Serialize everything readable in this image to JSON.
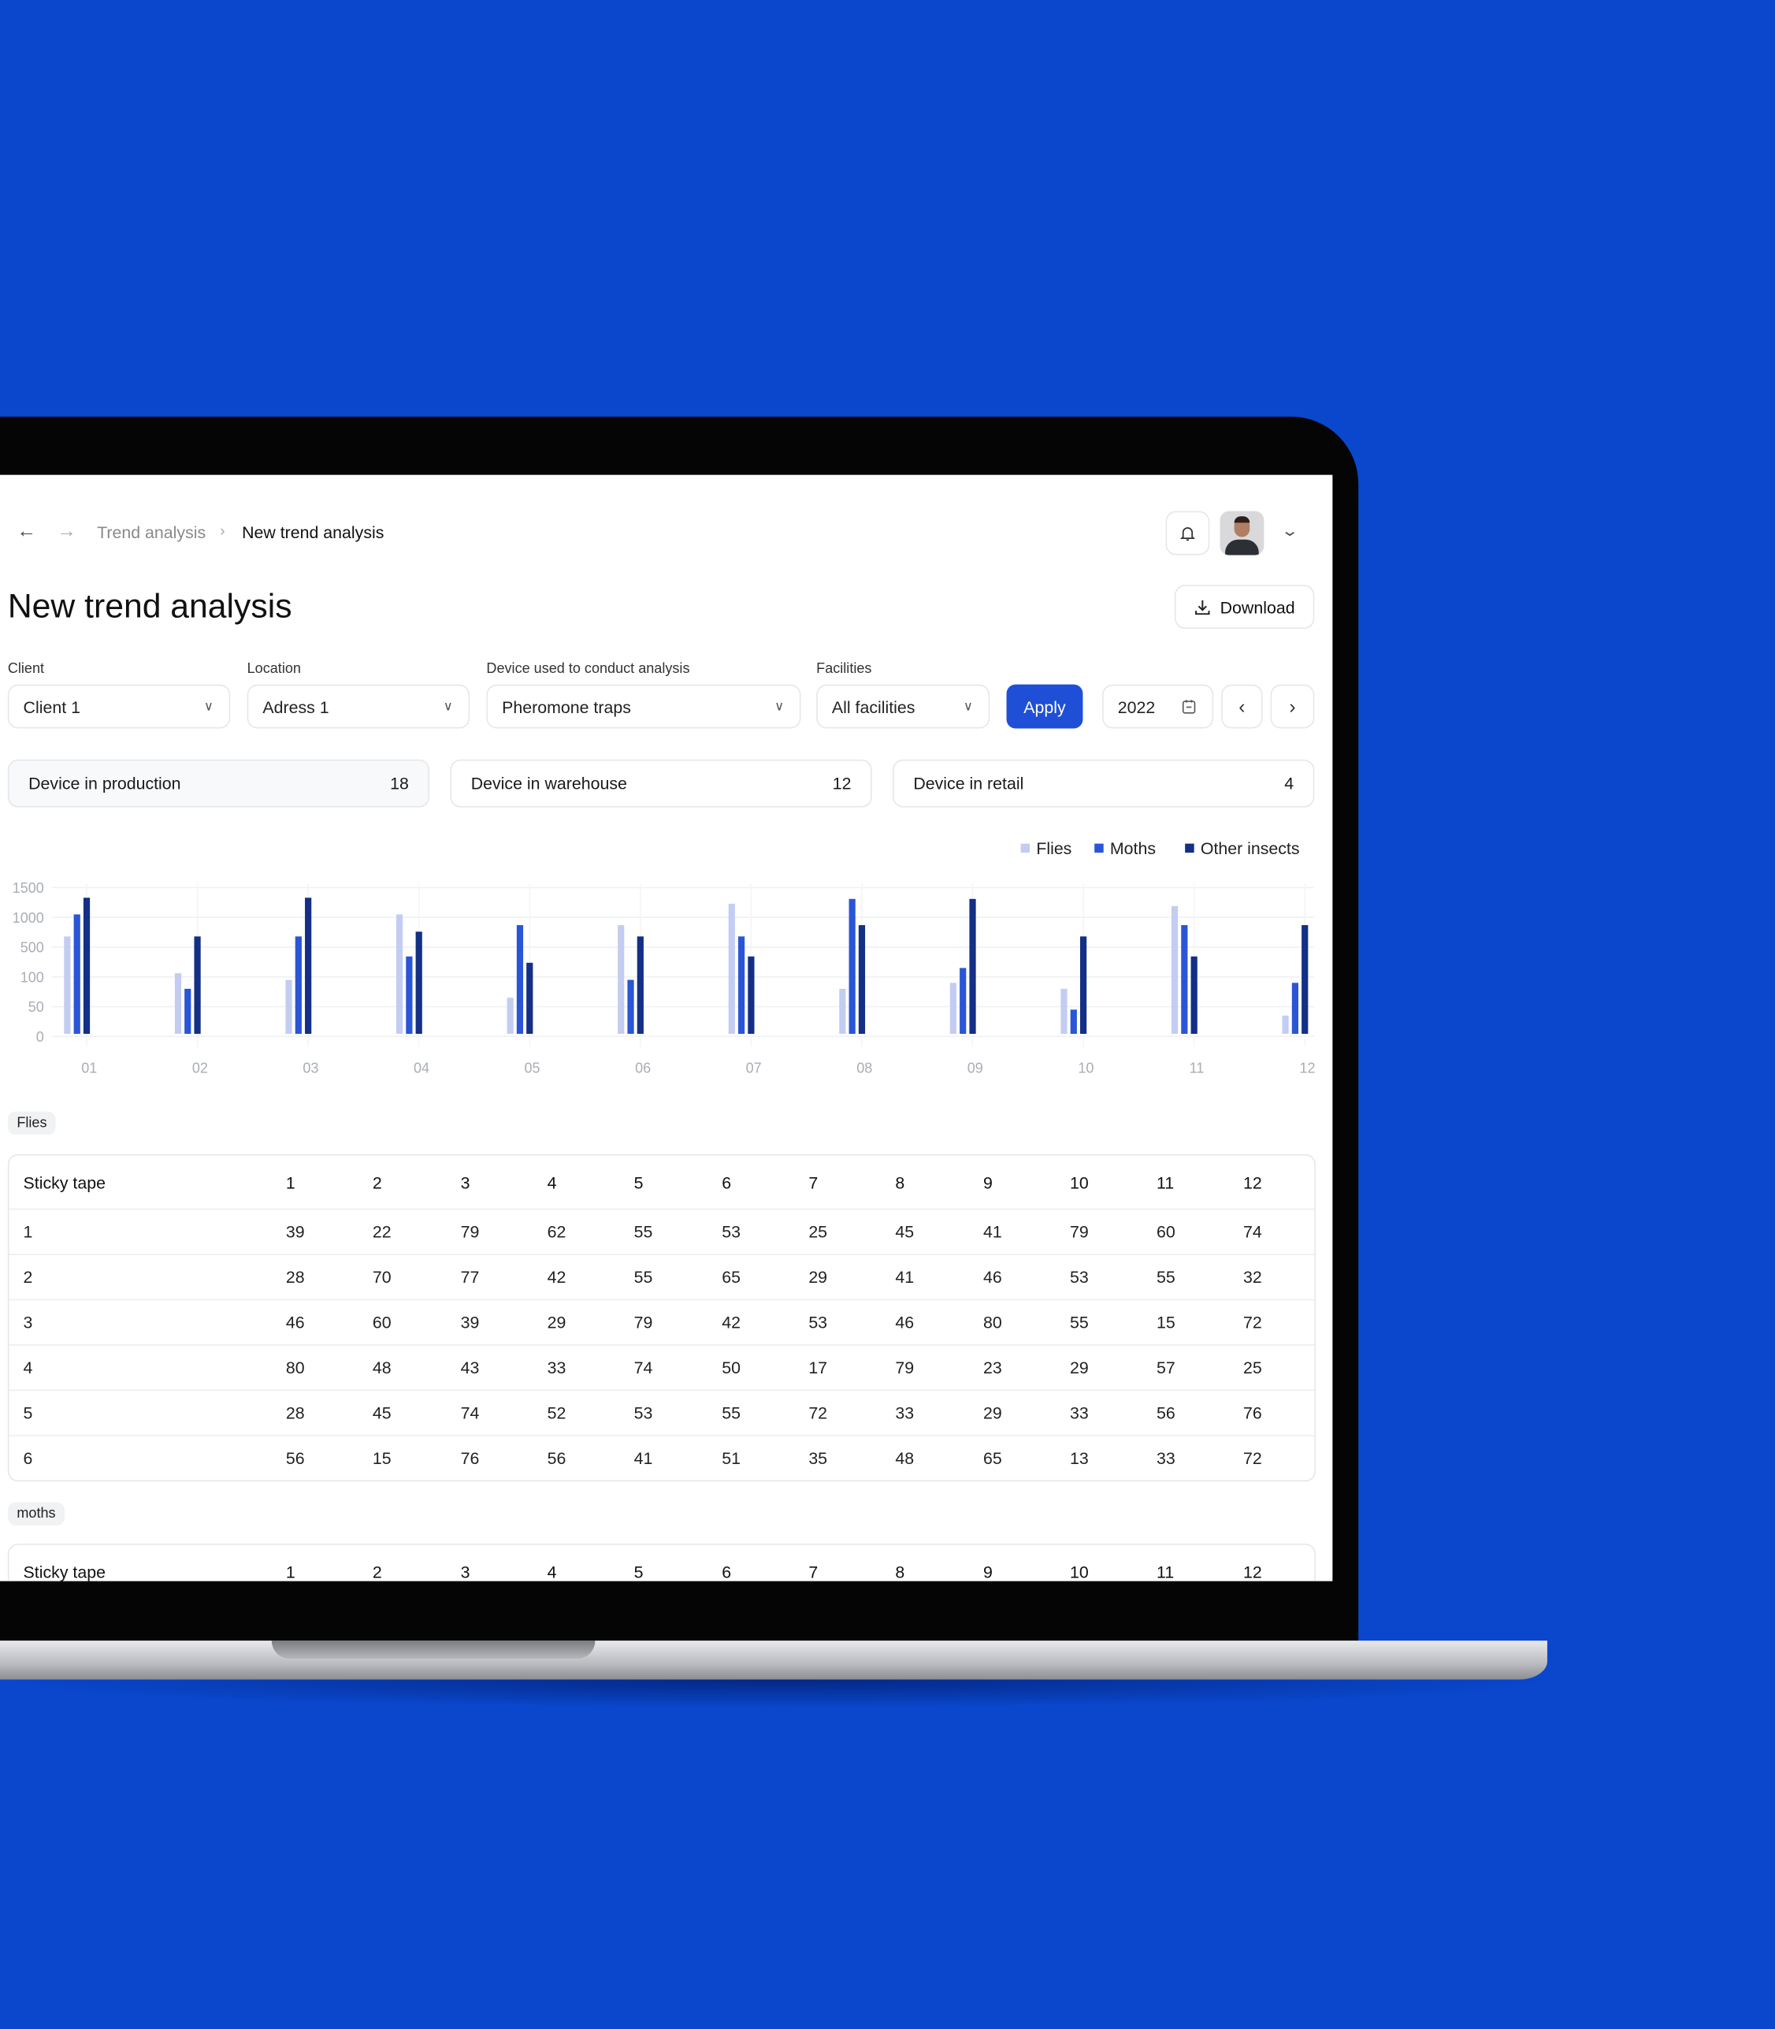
{
  "nav": {
    "back_icon": "arrow-left-icon",
    "forward_icon": "arrow-right-icon",
    "breadcrumb": [
      "Trend analysis",
      "New trend analysis"
    ],
    "avatar_alt": "user avatar"
  },
  "header": {
    "title": "New trend analysis",
    "download_label": "Download"
  },
  "filters": {
    "client": {
      "label": "Client",
      "value": "Client 1"
    },
    "location": {
      "label": "Location",
      "value": "Adress 1"
    },
    "device": {
      "label": "Device used to conduct analysis",
      "value": "Pheromone traps"
    },
    "facilities": {
      "label": "Facilities",
      "value": "All facilities"
    },
    "apply_label": "Apply",
    "year": "2022"
  },
  "cards": [
    {
      "label": "Device in production",
      "value": "18"
    },
    {
      "label": "Device in warehouse",
      "value": "12"
    },
    {
      "label": "Device in retail",
      "value": "4"
    }
  ],
  "colors": {
    "background": "#0a47cc",
    "flies": "#c3cdf2",
    "moths": "#2a55d6",
    "other": "#132f86",
    "apply": "#1f4fd6"
  },
  "chart_data": {
    "type": "bar",
    "categories": [
      "01",
      "02",
      "03",
      "04",
      "05",
      "06",
      "07",
      "08",
      "09",
      "10",
      "11",
      "12"
    ],
    "y_ticks": [
      0,
      50,
      100,
      500,
      1000,
      1500
    ],
    "ylim": [
      0,
      1500
    ],
    "grid": true,
    "legend_position": "top-right",
    "series": [
      {
        "name": "Flies",
        "values": [
          680,
          150,
          95,
          1050,
          65,
          870,
          1230,
          80,
          90,
          80,
          1190,
          35
        ]
      },
      {
        "name": "Moths",
        "values": [
          1050,
          80,
          680,
          375,
          870,
          95,
          680,
          1310,
          220,
          45,
          870,
          90
        ]
      },
      {
        "name": "Other insects",
        "values": [
          1330,
          680,
          1330,
          760,
          290,
          680,
          375,
          870,
          1310,
          680,
          375,
          870
        ]
      }
    ]
  },
  "tables": [
    {
      "chip": "Flies",
      "header": [
        "Sticky tape",
        "1",
        "2",
        "3",
        "4",
        "5",
        "6",
        "7",
        "8",
        "9",
        "10",
        "11",
        "12"
      ],
      "rows": [
        [
          "1",
          "39",
          "22",
          "79",
          "62",
          "55",
          "53",
          "25",
          "45",
          "41",
          "79",
          "60",
          "74"
        ],
        [
          "2",
          "28",
          "70",
          "77",
          "42",
          "55",
          "65",
          "29",
          "41",
          "46",
          "53",
          "55",
          "32"
        ],
        [
          "3",
          "46",
          "60",
          "39",
          "29",
          "79",
          "42",
          "53",
          "46",
          "80",
          "55",
          "15",
          "72"
        ],
        [
          "4",
          "80",
          "48",
          "43",
          "33",
          "74",
          "50",
          "17",
          "79",
          "23",
          "29",
          "57",
          "25"
        ],
        [
          "5",
          "28",
          "45",
          "74",
          "52",
          "53",
          "55",
          "72",
          "33",
          "29",
          "33",
          "56",
          "76"
        ],
        [
          "6",
          "56",
          "15",
          "76",
          "56",
          "41",
          "51",
          "35",
          "48",
          "65",
          "13",
          "33",
          "72"
        ]
      ]
    },
    {
      "chip": "moths",
      "header": [
        "Sticky tape",
        "1",
        "2",
        "3",
        "4",
        "5",
        "6",
        "7",
        "8",
        "9",
        "10",
        "11",
        "12"
      ],
      "rows": []
    }
  ]
}
